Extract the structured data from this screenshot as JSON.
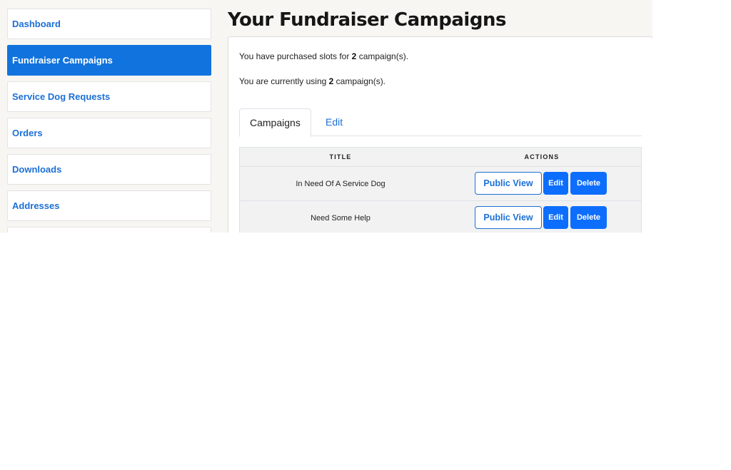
{
  "sidebar": {
    "items": [
      {
        "label": "Dashboard"
      },
      {
        "label": "Fundraiser Campaigns"
      },
      {
        "label": "Service Dog Requests"
      },
      {
        "label": "Orders"
      },
      {
        "label": "Downloads"
      },
      {
        "label": "Addresses"
      }
    ]
  },
  "main": {
    "title": "Your Fundraiser Campaigns",
    "purchased": {
      "prefix": "You have purchased slots for ",
      "count": "2",
      "suffix": " campaign(s)."
    },
    "using": {
      "prefix": "You are currently using ",
      "count": "2",
      "suffix": " campaign(s)."
    },
    "tabs": [
      {
        "label": "Campaigns"
      },
      {
        "label": "Edit"
      }
    ],
    "table": {
      "headers": [
        "TITLE",
        "ACTIONS"
      ],
      "rows": [
        {
          "title": "In Need Of A Service Dog",
          "public_view": "Public View",
          "edit": "Edit",
          "delete": "Delete"
        },
        {
          "title": "Need Some Help",
          "public_view": "Public View",
          "edit": "Edit",
          "delete": "Delete"
        }
      ]
    }
  },
  "colors": {
    "accent": "#1173dd",
    "link": "#1c6fd6",
    "button": "#0d6efd",
    "page_bg": "#f8f6f2"
  }
}
